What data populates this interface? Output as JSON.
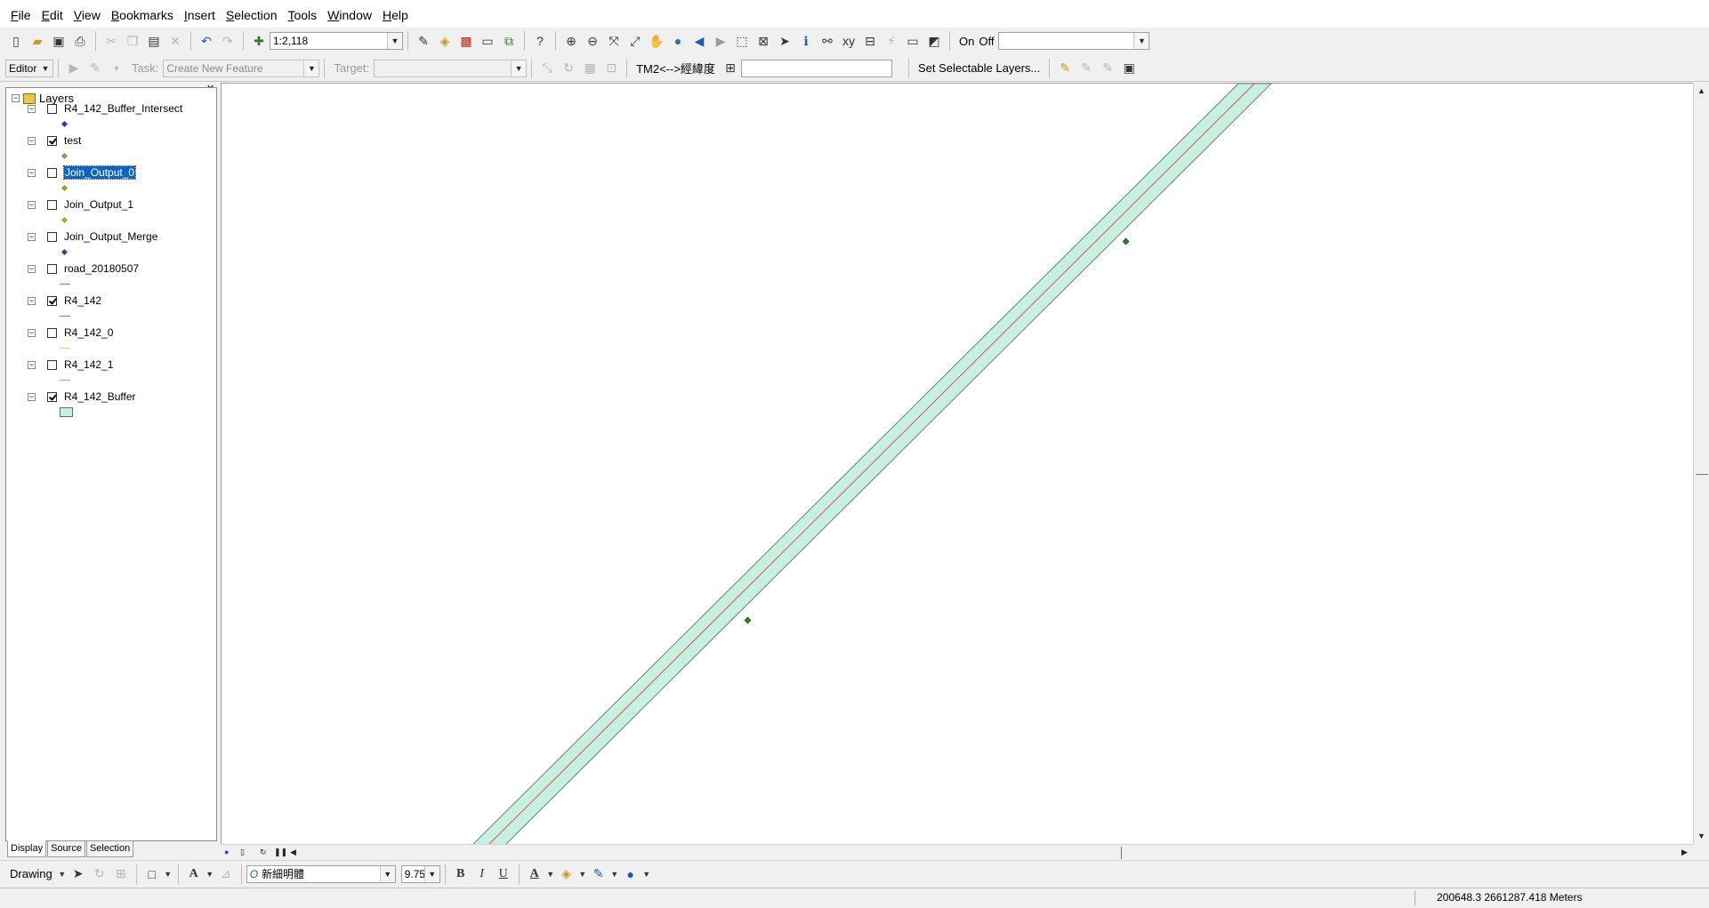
{
  "menu": [
    "File",
    "Edit",
    "View",
    "Bookmarks",
    "Insert",
    "Selection",
    "Tools",
    "Window",
    "Help"
  ],
  "standard_toolbar": {
    "scale_value": "1:2,118",
    "on_label": "On",
    "off_label": "Off"
  },
  "editor_toolbar": {
    "editor_label": "Editor",
    "task_label": "Task:",
    "task_value": "Create New Feature",
    "target_label": "Target:",
    "tm2_label": "TM2<-->經緯度",
    "selectable_label": "Set Selectable Layers..."
  },
  "toc": {
    "root_label": "Layers",
    "layers": [
      {
        "name": "R4_142_Buffer_Intersect",
        "checked": false,
        "symbol": "point",
        "color": "#2b3ba8"
      },
      {
        "name": "test",
        "checked": true,
        "symbol": "point",
        "color": "#6aa84f"
      },
      {
        "name": "Join_Output_0",
        "checked": false,
        "symbol": "point",
        "color": "#9a9a2a",
        "selected": true
      },
      {
        "name": "Join_Output_1",
        "checked": false,
        "symbol": "point",
        "color": "#a8a82a"
      },
      {
        "name": "Join_Output_Merge",
        "checked": false,
        "symbol": "point",
        "color": "#6b2a8f"
      },
      {
        "name": "road_20180507",
        "checked": false,
        "symbol": "line",
        "color": "#e06060"
      },
      {
        "name": "R4_142",
        "checked": true,
        "symbol": "line",
        "color": "#e06060"
      },
      {
        "name": "R4_142_0",
        "checked": false,
        "symbol": "line",
        "color": "#c7d66a"
      },
      {
        "name": "R4_142_1",
        "checked": false,
        "symbol": "line",
        "color": "#7cc47c"
      },
      {
        "name": "R4_142_Buffer",
        "checked": true,
        "symbol": "polygon",
        "color": "#c6f0e2"
      }
    ],
    "tabs": [
      "Display",
      "Source",
      "Selection"
    ]
  },
  "drawing_toolbar": {
    "drawing_label": "Drawing",
    "font_name": "新細明體",
    "font_size": "9.75",
    "bold": "B",
    "italic": "I",
    "underline": "U"
  },
  "status": {
    "coordinates": "200648.3  2661287.418 Meters"
  },
  "colors": {
    "buffer_fill": "#c6f0e2",
    "road_line": "#e0553f",
    "selection": "#0a64c8"
  }
}
